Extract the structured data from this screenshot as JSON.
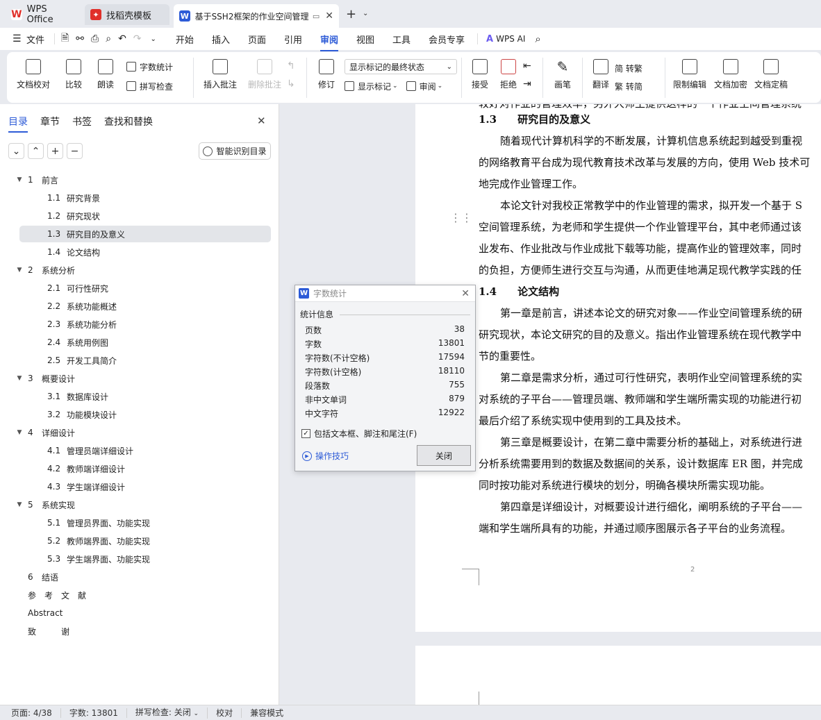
{
  "tabs": [
    {
      "label": "WPS Office",
      "icon": "wps-logo-icon"
    },
    {
      "label": "找稻壳模板",
      "icon": "docer-icon"
    },
    {
      "label": "基于SSH2框架的作业空间管理",
      "icon": "word-doc-icon"
    }
  ],
  "menu": {
    "file": "文件",
    "items": [
      "开始",
      "插入",
      "页面",
      "引用",
      "审阅",
      "视图",
      "工具",
      "会员专享"
    ],
    "active": "审阅",
    "ai": "WPS AI"
  },
  "ribbon": {
    "doc_check": "文档校对",
    "compare": "比较",
    "read_aloud": "朗读",
    "word_count": "字数统计",
    "spell_check": "拼写检查",
    "insert_comment": "插入批注",
    "delete_comment": "删除批注",
    "track": "修订",
    "markup_state": "显示标记的最终状态",
    "show_markup": "显示标记",
    "review": "审阅",
    "accept": "接受",
    "reject": "拒绝",
    "pen": "画笔",
    "translate": "翻译",
    "to_trad": "简 转繁",
    "to_simp": "繁 转简",
    "restrict": "限制编辑",
    "encrypt": "文档加密",
    "finalize": "文档定稿"
  },
  "panel": {
    "tabs": [
      "目录",
      "章节",
      "书签",
      "查找和替换"
    ],
    "active_tab": "目录",
    "smart_toc": "智能识别目录",
    "toc": [
      {
        "level": 1,
        "num": "1",
        "text": "前言",
        "expanded": true
      },
      {
        "level": 2,
        "num": "1.1",
        "text": "研究背景"
      },
      {
        "level": 2,
        "num": "1.2",
        "text": "研究现状"
      },
      {
        "level": 2,
        "num": "1.3",
        "text": "研究目的及意义",
        "selected": true
      },
      {
        "level": 2,
        "num": "1.4",
        "text": "论文结构"
      },
      {
        "level": 1,
        "num": "2",
        "text": "系统分析",
        "expanded": true
      },
      {
        "level": 2,
        "num": "2.1",
        "text": "可行性研究"
      },
      {
        "level": 2,
        "num": "2.2",
        "text": "系统功能概述"
      },
      {
        "level": 2,
        "num": "2.3",
        "text": "系统功能分析"
      },
      {
        "level": 2,
        "num": "2.4",
        "text": "系统用例图"
      },
      {
        "level": 2,
        "num": "2.5",
        "text": "开发工具简介"
      },
      {
        "level": 1,
        "num": "3",
        "text": "概要设计",
        "expanded": true
      },
      {
        "level": 2,
        "num": "3.1",
        "text": "数据库设计"
      },
      {
        "level": 2,
        "num": "3.2",
        "text": "功能模块设计"
      },
      {
        "level": 1,
        "num": "4",
        "text": "详细设计",
        "expanded": true
      },
      {
        "level": 2,
        "num": "4.1",
        "text": "管理员端详细设计"
      },
      {
        "level": 2,
        "num": "4.2",
        "text": "教师端详细设计"
      },
      {
        "level": 2,
        "num": "4.3",
        "text": "学生端详细设计"
      },
      {
        "level": 1,
        "num": "5",
        "text": "系统实现",
        "expanded": true
      },
      {
        "level": 2,
        "num": "5.1",
        "text": "管理员界面、功能实现"
      },
      {
        "level": 2,
        "num": "5.2",
        "text": "教师端界面、功能实现"
      },
      {
        "level": 2,
        "num": "5.3",
        "text": "学生端界面、功能实现"
      },
      {
        "level": 1,
        "num": "6",
        "text": "结语"
      },
      {
        "level": 1,
        "num": "",
        "text": "参　考　文　献"
      },
      {
        "level": 1,
        "num": "",
        "text": "Abstract"
      },
      {
        "level": 1,
        "num": "",
        "text": "致　　　谢"
      }
    ]
  },
  "doc": {
    "lines": [
      {
        "text": "较好对作业的管理效率，另外大师生提供这样的一个作业空间管理系统",
        "type": "p",
        "indent": false
      },
      {
        "text": "1.3　　研究目的及意义",
        "type": "h"
      },
      {
        "text": "随着现代计算机科学的不断发展，计算机信息系统起到越受到重视",
        "type": "p",
        "indent": true
      },
      {
        "text": "的网络教育平台成为现代教育技术改革与发展的方向，使用 Web 技术可",
        "type": "p"
      },
      {
        "text": "地完成作业管理工作。",
        "type": "p"
      },
      {
        "text": "本论文针对我校正常教学中的作业管理的需求，拟开发一个基于 S",
        "type": "p",
        "indent": true
      },
      {
        "text": "空间管理系统，为老师和学生提供一个作业管理平台，其中老师通过该",
        "type": "p"
      },
      {
        "text": "业发布、作业批改与作业成批下载等功能，提高作业的管理效率，同时",
        "type": "p"
      },
      {
        "text": "的负担，方便师生进行交互与沟通，从而更佳地满足现代教学实践的任",
        "type": "p"
      },
      {
        "text": "1.4　　论文结构",
        "type": "h"
      },
      {
        "text": "第一章是前言，讲述本论文的研究对象——作业空间管理系统的研",
        "type": "p",
        "indent": true
      },
      {
        "text": "研究现状，本论文研究的目的及意义。指出作业管理系统在现代教学中",
        "type": "p"
      },
      {
        "text": "节的重要性。",
        "type": "p"
      },
      {
        "text": "第二章是需求分析，通过可行性研究，表明作业空间管理系统的实",
        "type": "p",
        "indent": true
      },
      {
        "text": "对系统的子平台——管理员端、教师端和学生端所需实现的功能进行初",
        "type": "p"
      },
      {
        "text": "最后介绍了系统实现中使用到的工具及技术。",
        "type": "p"
      },
      {
        "text": "第三章是概要设计，在第二章中需要分析的基础上，对系统进行进",
        "type": "p",
        "indent": true
      },
      {
        "text": "分析系统需要用到的数据及数据间的关系，设计数据库 ER 图，并完成",
        "type": "p"
      },
      {
        "text": "同时按功能对系统进行模块的划分，明确各模块所需实现功能。",
        "type": "p"
      },
      {
        "text": "第四章是详细设计，对概要设计进行细化，阐明系统的子平台——",
        "type": "p",
        "indent": true
      },
      {
        "text": "端和学生端所具有的功能，并通过顺序图展示各子平台的业务流程。",
        "type": "p"
      }
    ],
    "page_number": "2"
  },
  "dialog": {
    "title": "字数统计",
    "section": "统计信息",
    "rows": [
      {
        "label": "页数",
        "value": "38"
      },
      {
        "label": "字数",
        "value": "13801"
      },
      {
        "label": "字符数(不计空格)",
        "value": "17594"
      },
      {
        "label": "字符数(计空格)",
        "value": "18110"
      },
      {
        "label": "段落数",
        "value": "755"
      },
      {
        "label": "非中文单词",
        "value": "879"
      },
      {
        "label": "中文字符",
        "value": "12922"
      }
    ],
    "checkbox": "包括文本框、脚注和尾注(F)",
    "checkbox_checked": true,
    "tips": "操作技巧",
    "close": "关闭"
  },
  "status": {
    "page": "页面: 4/38",
    "words": "字数: 13801",
    "spell": "拼写检查: 关闭",
    "proof": "校对",
    "compat": "兼容模式"
  },
  "colors": {
    "accent": "#2d5bd7",
    "wps_red": "#e0302a"
  }
}
